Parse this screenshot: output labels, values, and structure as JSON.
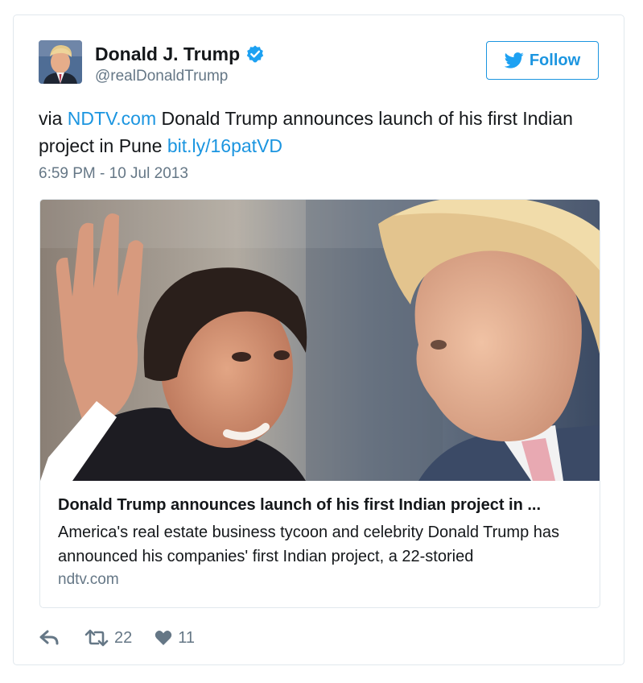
{
  "user": {
    "display_name": "Donald J. Trump",
    "handle": "@realDonaldTrump",
    "verified_icon": "verified-badge-icon",
    "avatar": "avatar"
  },
  "follow_button": {
    "label": "Follow",
    "icon": "twitter-bird-icon"
  },
  "tweet": {
    "prefix": "via ",
    "source_link": "NDTV.com",
    "body": " Donald Trump announces launch of his first Indian project in Pune ",
    "short_link": "bit.ly/16patVD",
    "timestamp": "6:59 PM - 10 Jul 2013"
  },
  "card": {
    "title": "Donald Trump announces launch of his first Indian project in ...",
    "description": "America's real estate business tycoon and celebrity Donald Trump has announced his companies' first Indian project, a 22-storied",
    "domain": "ndtv.com"
  },
  "actions": {
    "retweet_count": "22",
    "like_count": "11"
  },
  "colors": {
    "link": "#1b95e0",
    "secondary_text": "#657786",
    "border": "#e1e8ed"
  }
}
